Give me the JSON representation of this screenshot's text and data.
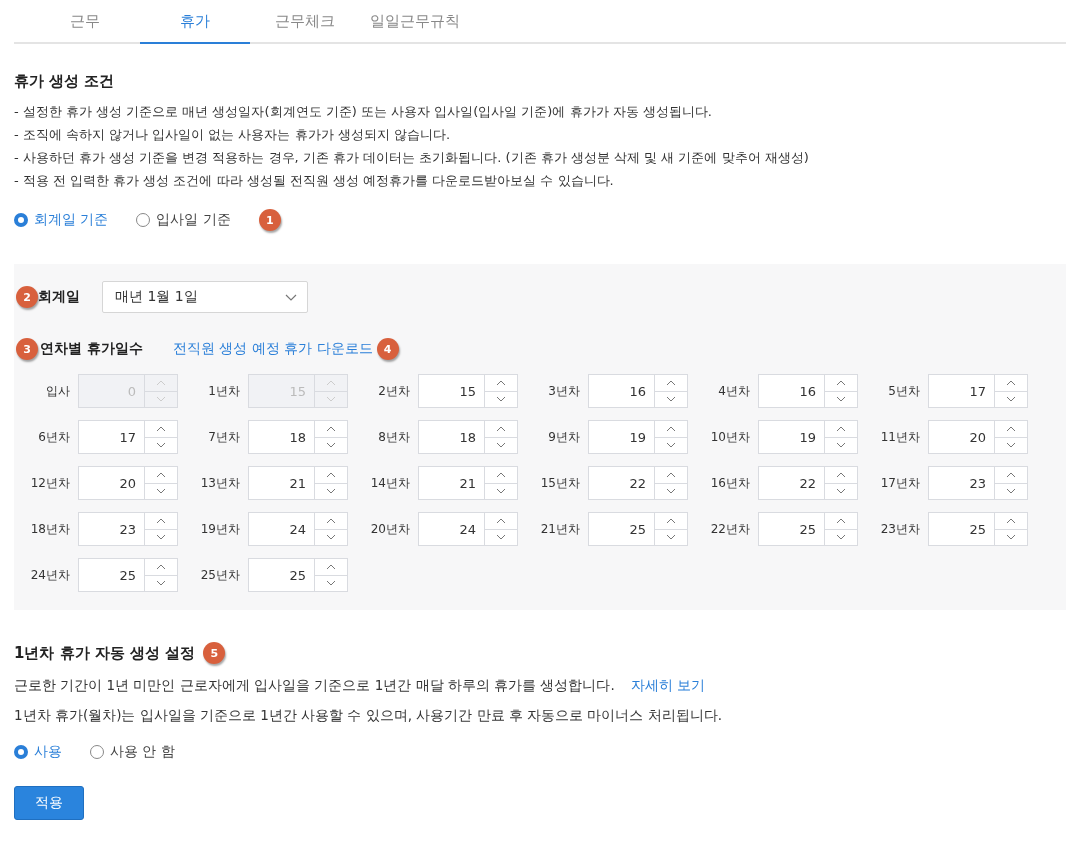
{
  "tabs": [
    {
      "label": "근무",
      "selected": false
    },
    {
      "label": "휴가",
      "selected": true
    },
    {
      "label": "근무체크",
      "selected": false
    },
    {
      "label": "일일근무규칙",
      "selected": false
    }
  ],
  "generation": {
    "title": "휴가 생성 조건",
    "notes": [
      "- 설정한 휴가 생성 기준으로 매년 생성일자(회계연도 기준) 또는 사용자 입사일(입사일 기준)에 휴가가 자동 생성됩니다.",
      "- 조직에 속하지 않거나 입사일이 없는 사용자는 휴가가 생성되지 않습니다.",
      "- 사용하던 휴가 생성 기준을 변경 적용하는 경우, 기존 휴가 데이터는 초기화됩니다. (기존 휴가 생성분 삭제 및 새 기준에 맞추어 재생성)",
      "- 적용 전 입력한 휴가 생성 조건에 따라 생성될 전직원 생성 예정휴가를 다운로드받아보실 수 있습니다."
    ],
    "options": [
      {
        "label": "회계일 기준",
        "selected": true
      },
      {
        "label": "입사일 기준",
        "selected": false
      }
    ],
    "badge": "1"
  },
  "settings": {
    "fiscal_label": "회계일",
    "fiscal_badge": "2",
    "fiscal_value": "매년 1월 1일",
    "days_label": "연차별 휴가일수",
    "days_badge": "3",
    "download_link": "전직원 생성 예정 휴가 다운로드",
    "download_badge": "4",
    "days": [
      {
        "label": "입사",
        "value": "0",
        "disabled": true
      },
      {
        "label": "1년차",
        "value": "15",
        "disabled": true
      },
      {
        "label": "2년차",
        "value": "15",
        "disabled": false
      },
      {
        "label": "3년차",
        "value": "16",
        "disabled": false
      },
      {
        "label": "4년차",
        "value": "16",
        "disabled": false
      },
      {
        "label": "5년차",
        "value": "17",
        "disabled": false
      },
      {
        "label": "6년차",
        "value": "17",
        "disabled": false
      },
      {
        "label": "7년차",
        "value": "18",
        "disabled": false
      },
      {
        "label": "8년차",
        "value": "18",
        "disabled": false
      },
      {
        "label": "9년차",
        "value": "19",
        "disabled": false
      },
      {
        "label": "10년차",
        "value": "19",
        "disabled": false
      },
      {
        "label": "11년차",
        "value": "20",
        "disabled": false
      },
      {
        "label": "12년차",
        "value": "20",
        "disabled": false
      },
      {
        "label": "13년차",
        "value": "21",
        "disabled": false
      },
      {
        "label": "14년차",
        "value": "21",
        "disabled": false
      },
      {
        "label": "15년차",
        "value": "22",
        "disabled": false
      },
      {
        "label": "16년차",
        "value": "22",
        "disabled": false
      },
      {
        "label": "17년차",
        "value": "23",
        "disabled": false
      },
      {
        "label": "18년차",
        "value": "23",
        "disabled": false
      },
      {
        "label": "19년차",
        "value": "24",
        "disabled": false
      },
      {
        "label": "20년차",
        "value": "24",
        "disabled": false
      },
      {
        "label": "21년차",
        "value": "25",
        "disabled": false
      },
      {
        "label": "22년차",
        "value": "25",
        "disabled": false
      },
      {
        "label": "23년차",
        "value": "25",
        "disabled": false
      },
      {
        "label": "24년차",
        "value": "25",
        "disabled": false
      },
      {
        "label": "25년차",
        "value": "25",
        "disabled": false
      }
    ]
  },
  "first_year": {
    "title": "1년차 휴가 자동 생성 설정",
    "badge": "5",
    "description": "근로한 기간이 1년 미만인 근로자에게 입사일을 기준으로 1년간 매달 하루의 휴가를 생성합니다.",
    "detail_link": "자세히 보기",
    "note": "1년차 휴가(월차)는 입사일을 기준으로 1년간 사용할 수 있으며, 사용기간 만료 후 자동으로 마이너스 처리됩니다.",
    "options": [
      {
        "label": "사용",
        "selected": true
      },
      {
        "label": "사용 안 함",
        "selected": false
      }
    ]
  },
  "apply_button": "적용"
}
